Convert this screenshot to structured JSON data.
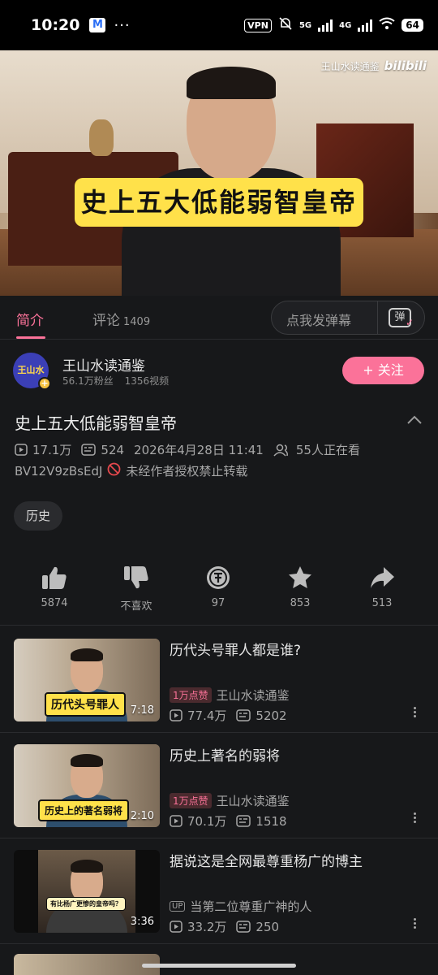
{
  "status_bar": {
    "time": "10:20",
    "mail_icon_letter": "M",
    "more": "···",
    "vpn": "VPN",
    "net1": "5G",
    "net2": "4G",
    "battery": "64"
  },
  "video": {
    "caption": "史上五大低能弱智皇帝",
    "watermark_name": "王山水读通鉴",
    "watermark_logo": "bilibili"
  },
  "tabs": {
    "intro": "简介",
    "comments": "评论",
    "comments_count": "1409",
    "danmu_placeholder": "点我发弹幕",
    "danmu_button": "弹"
  },
  "uploader": {
    "avatar_text": "王山水",
    "name": "王山水读通鉴",
    "fans": "56.1万粉丝",
    "videos": "1356视频",
    "follow": "+ 关注"
  },
  "detail": {
    "title": "史上五大低能弱智皇帝",
    "views": "17.1万",
    "danmaku": "524",
    "date": "2026年4月28日 11:41",
    "watching": "55人正在看",
    "bvid": "BV12V9zBsEdJ",
    "notice": "未经作者授权禁止转载",
    "tag": "历史"
  },
  "actions": [
    {
      "label": "5874"
    },
    {
      "label": "不喜欢"
    },
    {
      "label": "97"
    },
    {
      "label": "853"
    },
    {
      "label": "513"
    }
  ],
  "recommendations": [
    {
      "title": "历代头号罪人都是谁?",
      "thumb_caption": "历代头号罪人",
      "duration": "7:18",
      "badge": "1万点赞",
      "uploader": "王山水读通鉴",
      "views": "77.4万",
      "danmaku": "5202"
    },
    {
      "title": "历史上著名的弱将",
      "thumb_caption": "历史上的著名弱将",
      "duration": "2:10",
      "badge": "1万点赞",
      "uploader": "王山水读通鉴",
      "views": "70.1万",
      "danmaku": "1518"
    },
    {
      "title": "据说这是全网最尊重杨广的博主",
      "thumb_caption": "有比杨广更惨的皇帝吗？",
      "duration": "3:36",
      "up_tag": "UP",
      "uploader": "当第二位尊重广神的人",
      "views": "33.2万",
      "danmaku": "250"
    }
  ]
}
